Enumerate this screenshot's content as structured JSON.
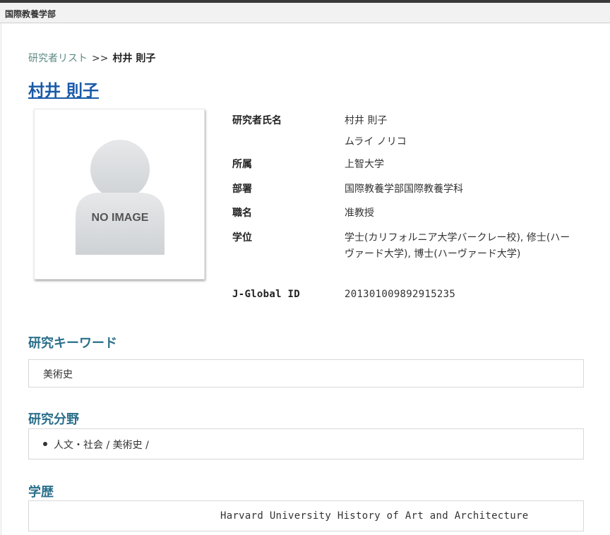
{
  "header": {
    "title": "国際教養学部"
  },
  "breadcrumb": {
    "list_link": "研究者リスト",
    "separator": ">>",
    "current": "村井 則子"
  },
  "profile": {
    "name_heading": "村井 則子",
    "photo_placeholder": "NO IMAGE",
    "fields": [
      {
        "label": "研究者氏名",
        "value": "村井 則子",
        "value2": "ムライ ノリコ"
      },
      {
        "label": "所属",
        "value": "上智大学"
      },
      {
        "label": "部署",
        "value": "国際教養学部国際教養学科"
      },
      {
        "label": "職名",
        "value": "准教授"
      },
      {
        "label": "学位",
        "value": "学士(カリフォルニア大学バークレー校), 修士(ハーヴァード大学), 博士(ハーヴァード大学)"
      },
      {
        "label": "J-Global ID",
        "value": "201301009892915235"
      }
    ]
  },
  "sections": {
    "keywords": {
      "title": "研究キーワード",
      "content": "美術史"
    },
    "fields": {
      "title": "研究分野",
      "items": [
        "人文・社会 / 美術史 /"
      ]
    },
    "education": {
      "title": "学歴",
      "content": "Harvard University History of Art and Architecture"
    }
  }
}
